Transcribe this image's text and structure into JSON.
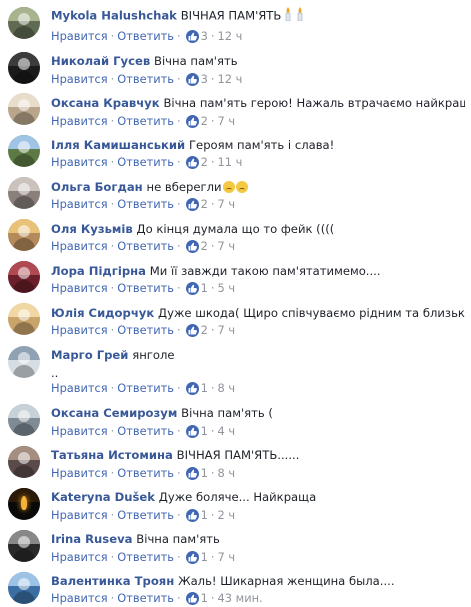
{
  "actions": {
    "like_label": "Нравится",
    "reply_label": "Ответить",
    "separator": "·"
  },
  "comments": [
    {
      "author": "Mykola Halushchak",
      "text": "ВІЧНАЯ ПАМ'ЯТЬ",
      "likes": "3",
      "time": "12 ч",
      "avatar_color": "#5f6b52",
      "avatar_top": "#a7b48d",
      "candles": 2
    },
    {
      "author": "Николай Гусев",
      "text": "Вічна пам'ять",
      "likes": "3",
      "time": "12 ч",
      "avatar_color": "#1b1b1b",
      "avatar_top": "#3c3c3c"
    },
    {
      "author": "Оксана Кравчук",
      "text": "Вічна пам'ять герою! Нажаль втрачаємо найкращих.",
      "likes": "2",
      "time": "7 ч",
      "avatar_color": "#b9a58b",
      "avatar_top": "#e8dccb"
    },
    {
      "author": "Ілля Камишанський",
      "text": "Героям пам'ять і слава!",
      "likes": "2",
      "time": "11 ч",
      "avatar_color": "#5d7a45",
      "avatar_top": "#9fc4e6"
    },
    {
      "author": "Ольга Богдан",
      "text": "не вберегли",
      "likes": "2",
      "time": "7 ч",
      "avatar_color": "#8a7f7a",
      "avatar_top": "#cbc2bd",
      "emoji_sad": 2
    },
    {
      "author": "Оля Кузьмів",
      "text": "До кінця думала що то фейк ((((",
      "likes": "2",
      "time": "7 ч",
      "avatar_color": "#b48a5a",
      "avatar_top": "#e9c27a"
    },
    {
      "author": "Лора Підгірна",
      "text": "Ми її завжди такою пам'ятатимемо....",
      "likes": "1",
      "time": "5 ч",
      "avatar_color": "#6b1f2a",
      "avatar_top": "#b04a52"
    },
    {
      "author": "Юлія Сидорчук",
      "text": "Дуже шкода( Щиро співчуваємо рідним та близьким(((",
      "likes": "2",
      "time": "7 ч",
      "avatar_color": "#c8a36a",
      "avatar_top": "#f0d7a4"
    },
    {
      "author": "Марго Грей",
      "text": "янголе",
      "text2": "..",
      "likes": "1",
      "time": "8 ч",
      "avatar_color": "#d6dde3",
      "avatar_top": "#8fa2b3"
    },
    {
      "author": "Оксана Семирозум",
      "text": "Вічна пам'ять (",
      "likes": "1",
      "time": "4 ч",
      "avatar_color": "#7f8b94",
      "avatar_top": "#c7d1d8"
    },
    {
      "author": "Татьяна Истомина",
      "text": "ВІЧНАЯ ПАМ'ЯТЬ......",
      "likes": "1",
      "time": "8 ч",
      "avatar_color": "#5a4a4a",
      "avatar_top": "#a58d80"
    },
    {
      "author": "Kateryna Dušek",
      "text": "Дуже боляче... Найкраща",
      "likes": "1",
      "time": "2 ч",
      "avatar_color": "#0a0a0a",
      "avatar_top": "#2a1a08",
      "avatar_candle": true
    },
    {
      "author": "Irina Ruseva",
      "text": "Вічна пам'ять",
      "likes": "1",
      "time": "7 ч",
      "avatar_color": "#2a2a2a",
      "avatar_top": "#888888"
    },
    {
      "author": "Валентинка Троян",
      "text": "Жаль! Шикарная женщина была....",
      "likes": "1",
      "time": "43 мин.",
      "avatar_color": "#3b6fa3",
      "avatar_top": "#9cc2e6"
    }
  ]
}
